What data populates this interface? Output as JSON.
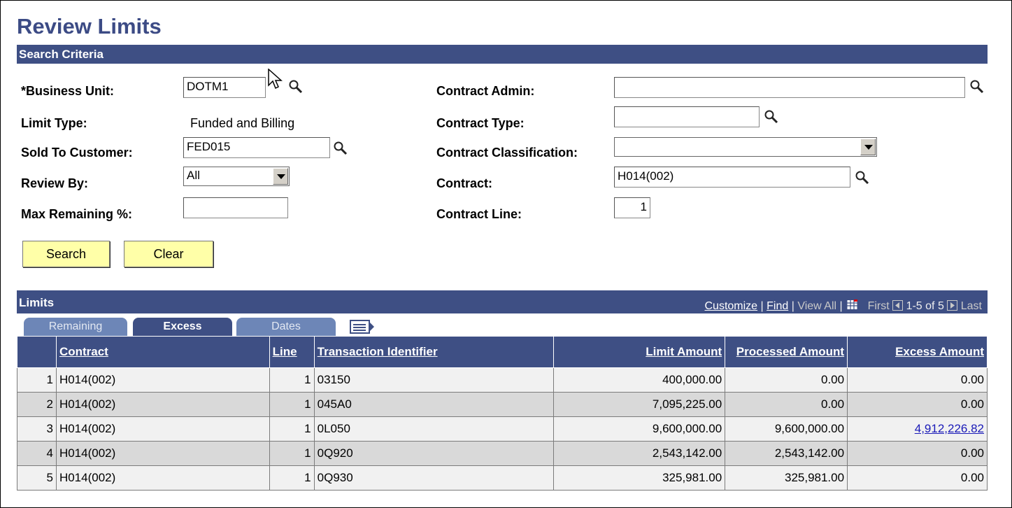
{
  "page": {
    "title": "Review Limits"
  },
  "search_criteria": {
    "header": "Search Criteria",
    "business_unit": {
      "label": "*Business Unit:",
      "value": "DOTM1"
    },
    "limit_type": {
      "label": "Limit Type:",
      "value": "Funded and Billing"
    },
    "sold_to_customer": {
      "label": "Sold To Customer:",
      "value": "FED015"
    },
    "review_by": {
      "label": "Review By:",
      "value": "All"
    },
    "max_remaining": {
      "label": "Max Remaining %:",
      "value": ""
    },
    "contract_admin": {
      "label": "Contract Admin:",
      "value": ""
    },
    "contract_type": {
      "label": "Contract Type:",
      "value": ""
    },
    "contract_classification": {
      "label": "Contract Classification:",
      "value": ""
    },
    "contract": {
      "label": "Contract:",
      "value": "H014(002)"
    },
    "contract_line": {
      "label": "Contract Line:",
      "value": "1"
    },
    "search_button": "Search",
    "clear_button": "Clear"
  },
  "limits": {
    "header": "Limits",
    "customize": "Customize",
    "find": "Find",
    "view_all": "View All",
    "sep": "|",
    "first": "First",
    "range": "1-5 of 5",
    "last": "Last",
    "tabs": [
      {
        "label": "Remaining"
      },
      {
        "label": "Excess"
      },
      {
        "label": "Dates"
      }
    ],
    "columns": [
      "Contract",
      "Line",
      "Transaction Identifier",
      "Limit Amount",
      "Processed Amount",
      "Excess Amount"
    ],
    "rows": [
      {
        "num": "1",
        "contract": "H014(002)",
        "line": "1",
        "txn": "03150",
        "limit": "400,000.00",
        "processed": "0.00",
        "excess": "0.00"
      },
      {
        "num": "2",
        "contract": "H014(002)",
        "line": "1",
        "txn": "045A0",
        "limit": "7,095,225.00",
        "processed": "0.00",
        "excess": "0.00"
      },
      {
        "num": "3",
        "contract": "H014(002)",
        "line": "1",
        "txn": "0L050",
        "limit": "9,600,000.00",
        "processed": "9,600,000.00",
        "excess": "4,912,226.82"
      },
      {
        "num": "4",
        "contract": "H014(002)",
        "line": "1",
        "txn": "0Q920",
        "limit": "2,543,142.00",
        "processed": "2,543,142.00",
        "excess": "0.00"
      },
      {
        "num": "5",
        "contract": "H014(002)",
        "line": "1",
        "txn": "0Q930",
        "limit": "325,981.00",
        "processed": "325,981.00",
        "excess": "0.00"
      }
    ]
  }
}
